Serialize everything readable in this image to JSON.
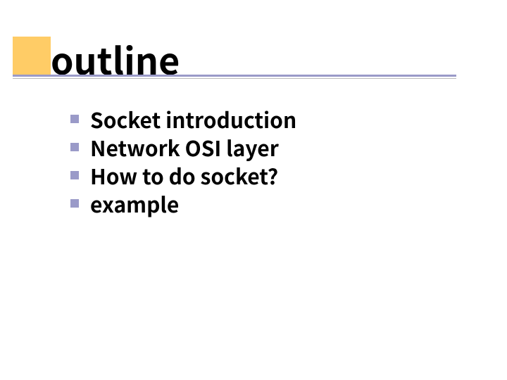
{
  "slide": {
    "title": "outline",
    "bullets": [
      "Socket introduction",
      "Network OSI layer",
      "How to do socket?",
      "example"
    ]
  }
}
